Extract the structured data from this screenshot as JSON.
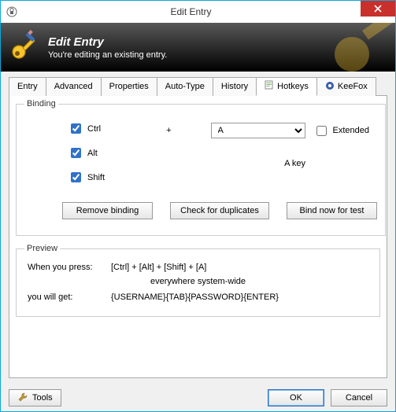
{
  "window": {
    "title": "Edit Entry"
  },
  "banner": {
    "title": "Edit Entry",
    "subtitle": "You're editing an existing entry."
  },
  "tabs": {
    "entry": "Entry",
    "advanced": "Advanced",
    "properties": "Properties",
    "autotype": "Auto-Type",
    "history": "History",
    "hotkeys": "Hotkeys",
    "keefox": "KeeFox"
  },
  "binding": {
    "legend": "Binding",
    "ctrl": "Ctrl",
    "alt": "Alt",
    "shift": "Shift",
    "plus": "+",
    "key_selected": "A",
    "extended": "Extended",
    "key_desc": "A key",
    "btn_remove": "Remove binding",
    "btn_check": "Check for duplicates",
    "btn_bind": "Bind now for test"
  },
  "preview": {
    "legend": "Preview",
    "press_label": "When you press:",
    "press_value": "[Ctrl] + [Alt] + [Shift] + [A]",
    "scope": "everywhere system-wide",
    "get_label": "you will get:",
    "get_value": "{USERNAME}{TAB}{PASSWORD}{ENTER}"
  },
  "footer": {
    "tools": "Tools",
    "ok": "OK",
    "cancel": "Cancel"
  }
}
